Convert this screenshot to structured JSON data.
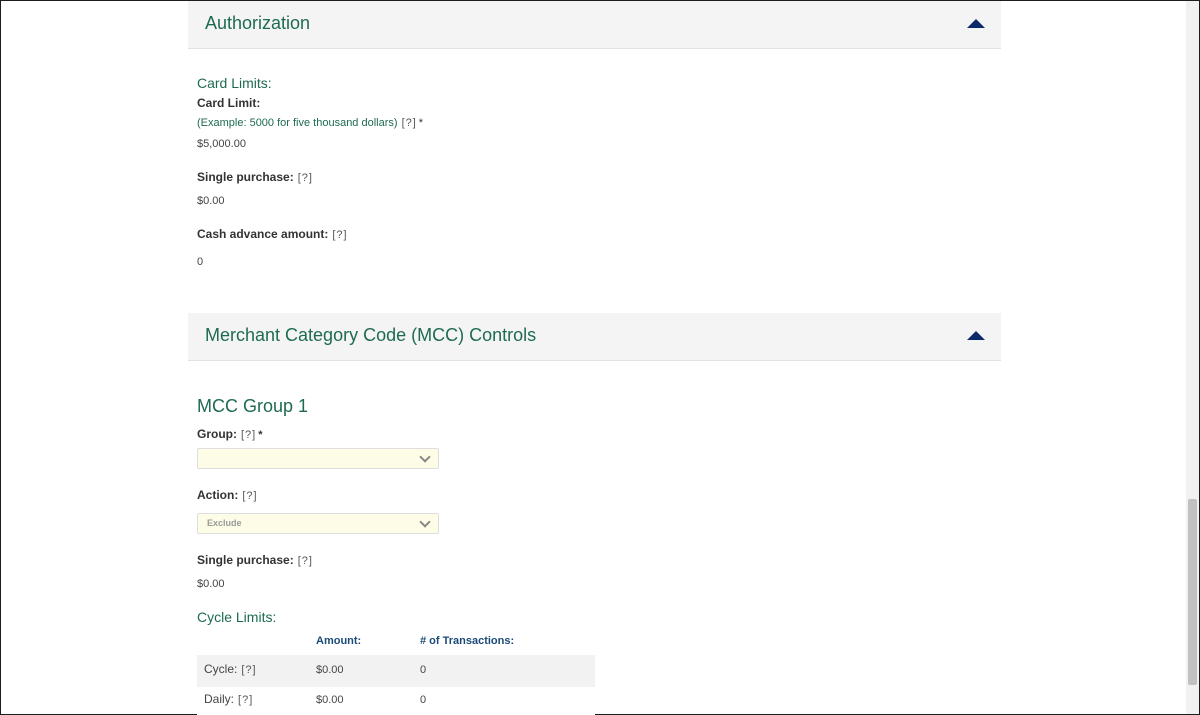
{
  "authorization": {
    "title": "Authorization",
    "card_limits_heading": "Card Limits:",
    "card_limit_label": "Card Limit:",
    "card_limit_hint": "(Example: 5000 for five thousand dollars)",
    "card_limit_value": "$5,000.00",
    "single_purchase_label": "Single purchase:",
    "single_purchase_value": "$0.00",
    "cash_advance_label": "Cash advance amount:",
    "cash_advance_value": "0"
  },
  "mcc": {
    "title": "Merchant Category Code (MCC) Controls",
    "group_heading": "MCC Group 1",
    "group_label": "Group:",
    "group_value": "",
    "action_label": "Action:",
    "action_value": "Exclude",
    "single_purchase_label": "Single purchase:",
    "single_purchase_value": "$0.00",
    "cycle_limits_heading": "Cycle Limits:",
    "col_amount": "Amount:",
    "col_transactions": "# of Transactions:",
    "rows": [
      {
        "label": "Cycle:",
        "amount": "$0.00",
        "transactions": "0"
      },
      {
        "label": "Daily:",
        "amount": "$0.00",
        "transactions": "0"
      }
    ]
  },
  "common": {
    "help": "[?]",
    "required": "*"
  }
}
